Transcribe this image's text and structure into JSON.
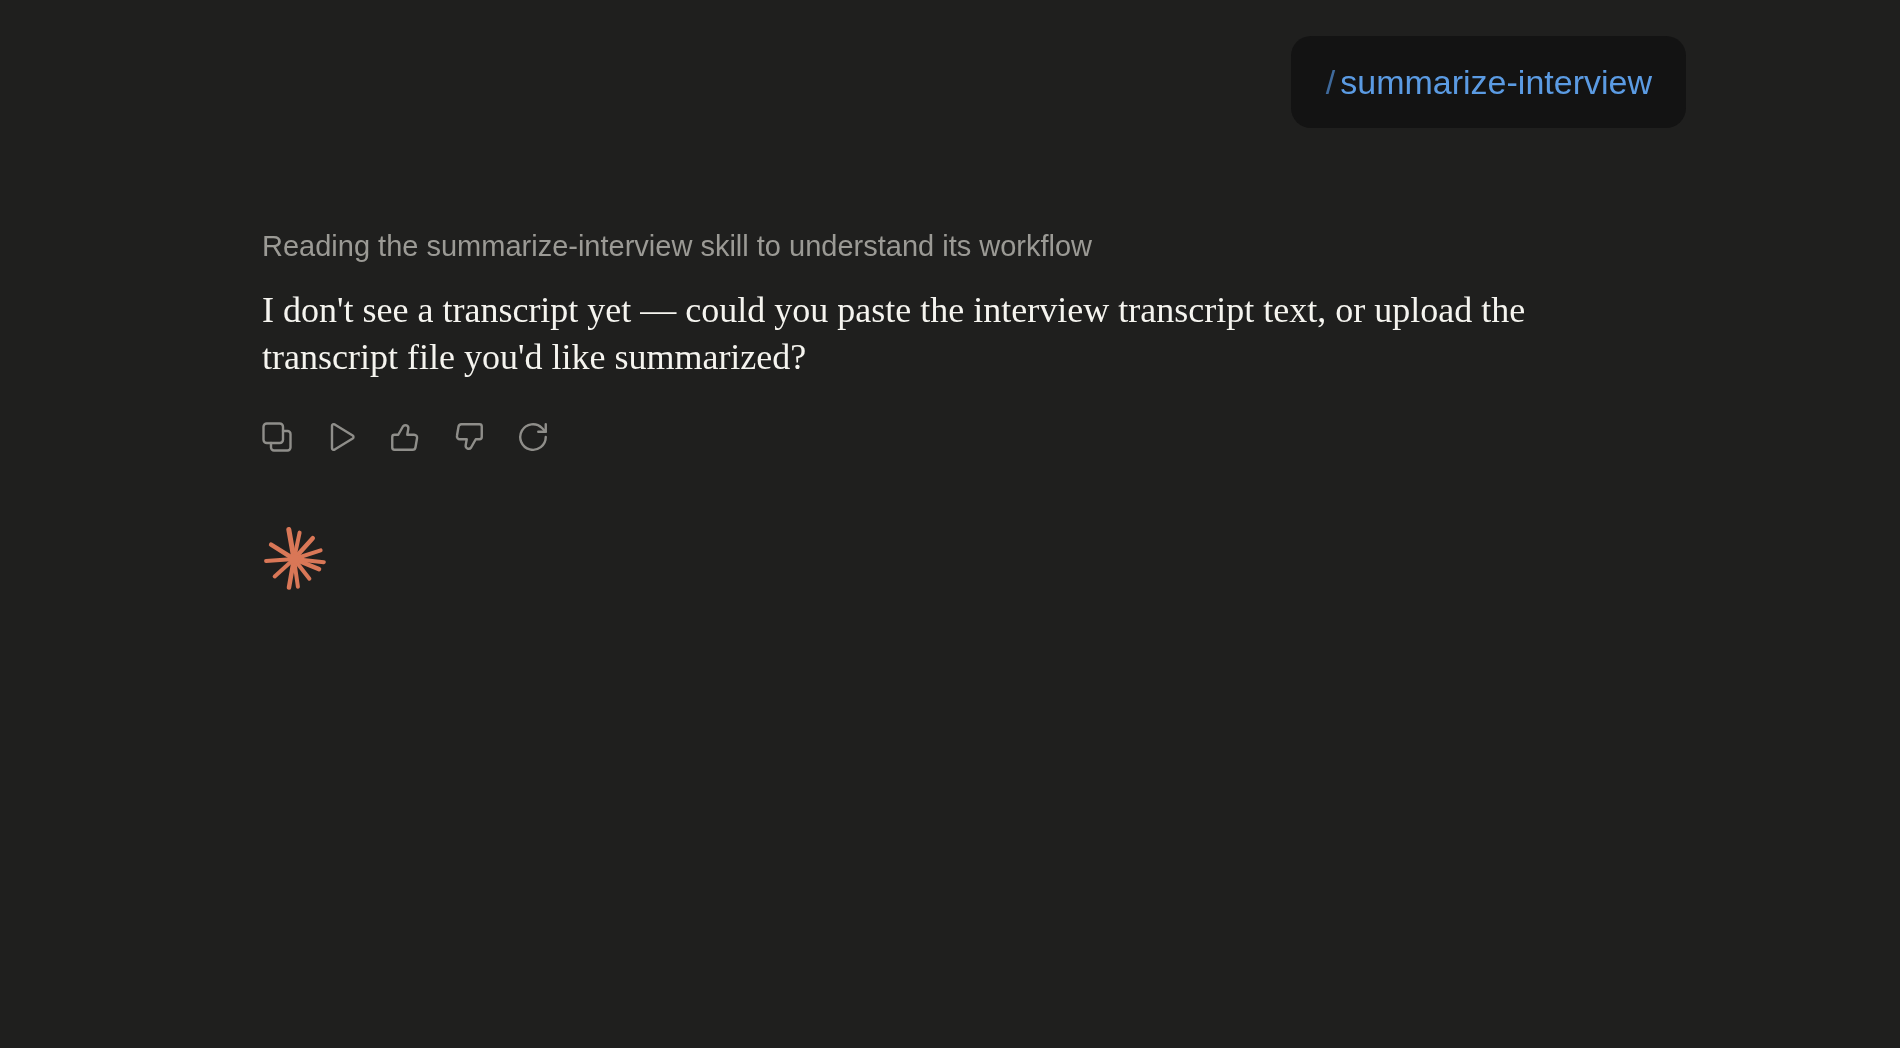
{
  "user_message": {
    "prefix": "/",
    "command": "summarize-interview"
  },
  "assistant": {
    "status": "Reading the summarize-interview skill to understand its workflow",
    "message": "I don't see a transcript yet — could you paste the interview transcript text, or upload the transcript file you'd like summarized?"
  },
  "generating": true
}
